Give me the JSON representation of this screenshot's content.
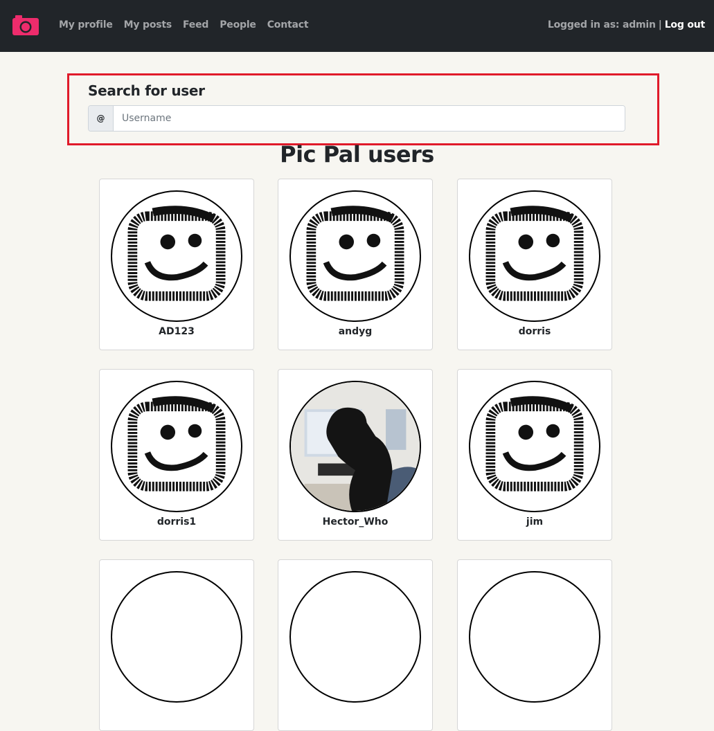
{
  "navbar": {
    "logo_icon": "camera-icon",
    "brand_color": "#ee2c6c",
    "links": [
      "My profile",
      "My posts",
      "Feed",
      "People",
      "Contact"
    ],
    "logged_in_label": "Logged in as: admin",
    "separator": "|",
    "logout_label": "Log out"
  },
  "search": {
    "title": "Search for user",
    "prefix": "@",
    "placeholder": "Username",
    "value": "",
    "highlight_color": "#e01a2a"
  },
  "main": {
    "title": "Pic Pal users",
    "users": [
      {
        "name": "AD123",
        "avatar": "smiley-icon"
      },
      {
        "name": "andyg",
        "avatar": "smiley-icon"
      },
      {
        "name": "dorris",
        "avatar": "smiley-icon"
      },
      {
        "name": "dorris1",
        "avatar": "smiley-icon"
      },
      {
        "name": "Hector_Who",
        "avatar": "dog-photo"
      },
      {
        "name": "jim",
        "avatar": "smiley-icon"
      }
    ]
  }
}
